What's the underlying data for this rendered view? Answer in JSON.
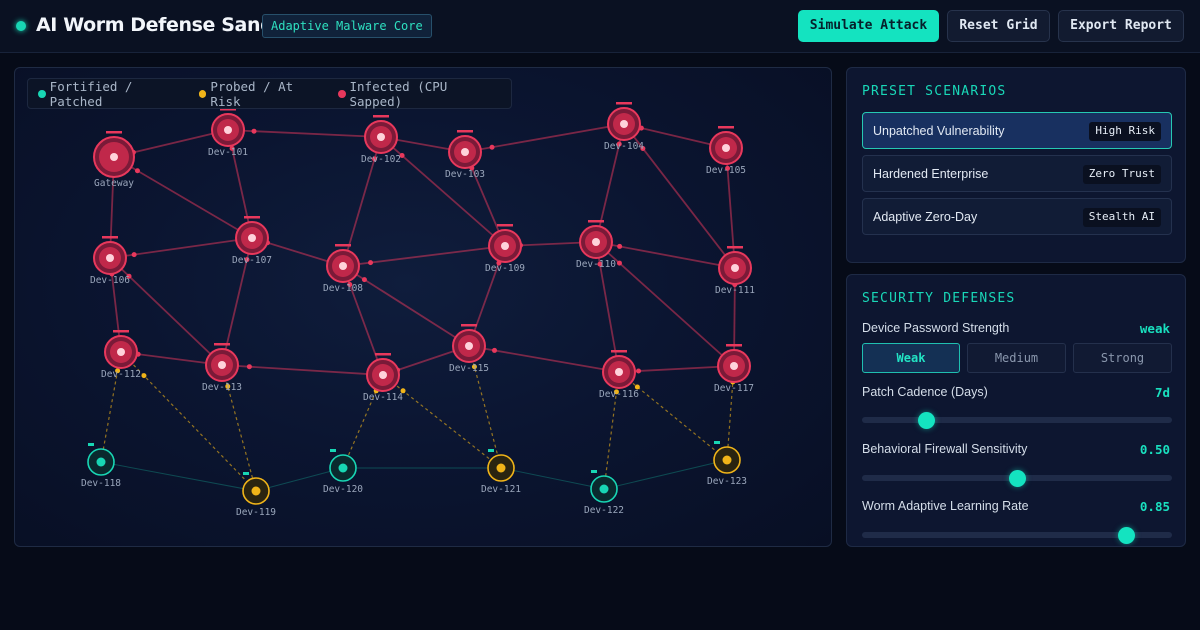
{
  "header": {
    "title": "AI Worm Defense Sandbox",
    "badge": "Adaptive Malware Core",
    "buttons": {
      "simulate": "Simulate Attack",
      "reset": "Reset Grid",
      "export": "Export Report"
    }
  },
  "colors": {
    "accent": "#14e3c0",
    "infected": "#e8385c",
    "probed": "#f0b419",
    "fortified": "#18d6b4"
  },
  "legend": [
    {
      "label": "Fortified / Patched",
      "color": "#18d6b4"
    },
    {
      "label": "Probed / At Risk",
      "color": "#f0b419"
    },
    {
      "label": "Infected (CPU Sapped)",
      "color": "#e8385c"
    }
  ],
  "network": {
    "nodes": [
      {
        "id": "Gateway",
        "state": "infected",
        "gateway": true
      },
      {
        "id": "Dev-101",
        "state": "infected"
      },
      {
        "id": "Dev-102",
        "state": "infected"
      },
      {
        "id": "Dev-103",
        "state": "infected"
      },
      {
        "id": "Dev-104",
        "state": "infected"
      },
      {
        "id": "Dev-105",
        "state": "infected"
      },
      {
        "id": "Dev-106",
        "state": "infected"
      },
      {
        "id": "Dev-107",
        "state": "infected"
      },
      {
        "id": "Dev-108",
        "state": "infected"
      },
      {
        "id": "Dev-109",
        "state": "infected"
      },
      {
        "id": "Dev-110",
        "state": "infected"
      },
      {
        "id": "Dev-111",
        "state": "infected"
      },
      {
        "id": "Dev-112",
        "state": "infected"
      },
      {
        "id": "Dev-113",
        "state": "infected"
      },
      {
        "id": "Dev-114",
        "state": "infected"
      },
      {
        "id": "Dev-115",
        "state": "infected"
      },
      {
        "id": "Dev-116",
        "state": "infected"
      },
      {
        "id": "Dev-117",
        "state": "infected"
      },
      {
        "id": "Dev-118",
        "state": "fortified"
      },
      {
        "id": "Dev-119",
        "state": "probed"
      },
      {
        "id": "Dev-120",
        "state": "fortified"
      },
      {
        "id": "Dev-121",
        "state": "probed"
      },
      {
        "id": "Dev-122",
        "state": "fortified"
      },
      {
        "id": "Dev-123",
        "state": "probed"
      }
    ],
    "links": [
      [
        "Gateway",
        "Dev-101"
      ],
      [
        "Gateway",
        "Dev-107"
      ],
      [
        "Gateway",
        "Dev-106"
      ],
      [
        "Dev-101",
        "Dev-102"
      ],
      [
        "Dev-101",
        "Dev-107"
      ],
      [
        "Dev-102",
        "Dev-103"
      ],
      [
        "Dev-102",
        "Dev-108"
      ],
      [
        "Dev-102",
        "Dev-109"
      ],
      [
        "Dev-103",
        "Dev-104"
      ],
      [
        "Dev-103",
        "Dev-109"
      ],
      [
        "Dev-104",
        "Dev-105"
      ],
      [
        "Dev-104",
        "Dev-110"
      ],
      [
        "Dev-104",
        "Dev-111"
      ],
      [
        "Dev-105",
        "Dev-111"
      ],
      [
        "Dev-106",
        "Dev-107"
      ],
      [
        "Dev-106",
        "Dev-112"
      ],
      [
        "Dev-106",
        "Dev-113"
      ],
      [
        "Dev-107",
        "Dev-108"
      ],
      [
        "Dev-107",
        "Dev-113"
      ],
      [
        "Dev-108",
        "Dev-109"
      ],
      [
        "Dev-108",
        "Dev-114"
      ],
      [
        "Dev-108",
        "Dev-115"
      ],
      [
        "Dev-109",
        "Dev-110"
      ],
      [
        "Dev-109",
        "Dev-115"
      ],
      [
        "Dev-110",
        "Dev-111"
      ],
      [
        "Dev-110",
        "Dev-116"
      ],
      [
        "Dev-110",
        "Dev-117"
      ],
      [
        "Dev-111",
        "Dev-117"
      ],
      [
        "Dev-112",
        "Dev-113"
      ],
      [
        "Dev-113",
        "Dev-114"
      ],
      [
        "Dev-114",
        "Dev-115"
      ],
      [
        "Dev-115",
        "Dev-116"
      ],
      [
        "Dev-116",
        "Dev-117"
      ],
      [
        "Dev-112",
        "Dev-118",
        "probe"
      ],
      [
        "Dev-112",
        "Dev-119",
        "probe"
      ],
      [
        "Dev-113",
        "Dev-119",
        "probe"
      ],
      [
        "Dev-114",
        "Dev-120",
        "probe"
      ],
      [
        "Dev-114",
        "Dev-121",
        "probe"
      ],
      [
        "Dev-115",
        "Dev-121",
        "probe"
      ],
      [
        "Dev-116",
        "Dev-122",
        "probe"
      ],
      [
        "Dev-116",
        "Dev-123",
        "probe"
      ],
      [
        "Dev-117",
        "Dev-123",
        "probe"
      ],
      [
        "Dev-118",
        "Dev-119",
        "safe"
      ],
      [
        "Dev-119",
        "Dev-120",
        "safe"
      ],
      [
        "Dev-120",
        "Dev-121",
        "safe"
      ],
      [
        "Dev-121",
        "Dev-122",
        "safe"
      ],
      [
        "Dev-122",
        "Dev-123",
        "safe"
      ]
    ]
  },
  "scenarios": {
    "title": "PRESET SCENARIOS",
    "items": [
      {
        "name": "Unpatched Vulnerability",
        "tag": "High Risk",
        "active": true
      },
      {
        "name": "Hardened Enterprise",
        "tag": "Zero Trust",
        "active": false
      },
      {
        "name": "Adaptive Zero-Day",
        "tag": "Stealth AI",
        "active": false
      }
    ]
  },
  "defenses": {
    "title": "SECURITY DEFENSES",
    "password": {
      "label": "Device Password Strength",
      "value": "weak",
      "options": [
        "Weak",
        "Medium",
        "Strong"
      ],
      "selected": 0
    },
    "patch": {
      "label": "Patch Cadence (Days)",
      "display": "7d",
      "value": 7,
      "min": 1,
      "max": 30
    },
    "firewall": {
      "label": "Behavioral Firewall Sensitivity",
      "display": "0.50",
      "value": 0.5,
      "min": 0,
      "max": 1
    },
    "learning": {
      "label": "Worm Adaptive Learning Rate",
      "display": "0.85",
      "value": 0.85,
      "min": 0,
      "max": 1
    }
  }
}
